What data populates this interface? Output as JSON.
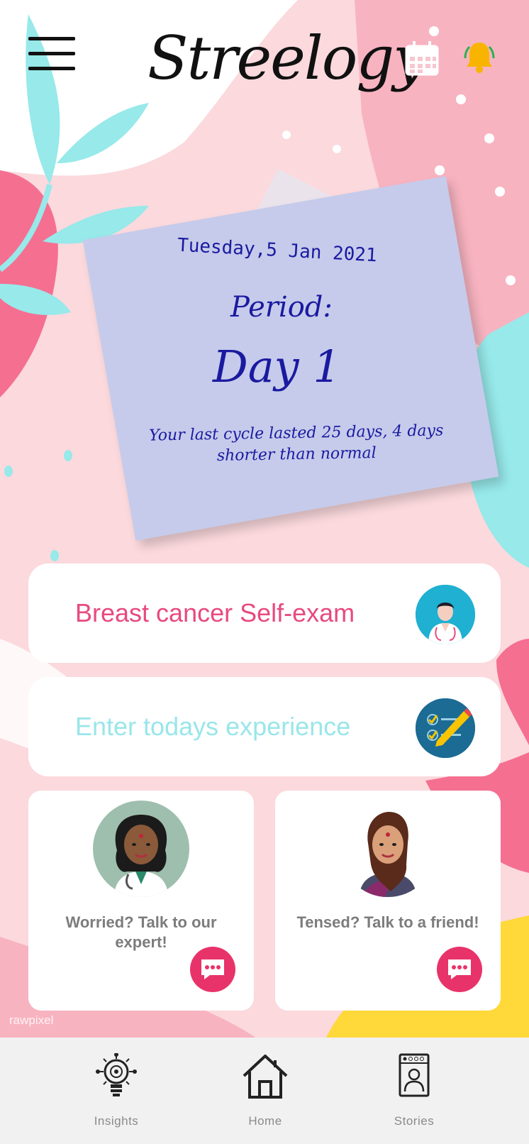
{
  "app": {
    "logo_text": "Streelogy"
  },
  "header": {
    "menu_icon": "hamburger-menu-icon",
    "calendar_icon": "calendar-icon",
    "bell_icon": "bell-icon",
    "bell_color": "#f8b400"
  },
  "note": {
    "date": "Tuesday,5 Jan 2021",
    "period_label": "Period:",
    "day": "Day 1",
    "message": "Your last  cycle lasted 25 days, 4 days shorter than normal"
  },
  "cards": [
    {
      "label": "Breast cancer Self-exam",
      "icon": "doctor-avatar-icon",
      "color": "#e84a7e"
    },
    {
      "label": "Enter todays experience",
      "icon": "checklist-pencil-icon",
      "color": "#99e6ea"
    }
  ],
  "talk": [
    {
      "text": "Worried? Talk to our expert!",
      "icon": "doctor-woman-avatar-icon"
    },
    {
      "text": "Tensed? Talk to a friend!",
      "icon": "woman-friend-avatar-icon"
    }
  ],
  "watermark": "rawpixel",
  "nav": [
    {
      "label": "Insights",
      "icon": "lightbulb-brain-icon"
    },
    {
      "label": "Home",
      "icon": "home-icon"
    },
    {
      "label": "Stories",
      "icon": "stories-person-icon"
    }
  ],
  "colors": {
    "accent_pink": "#e84a7e",
    "accent_teal": "#99e6ea",
    "note": "#c6cbeb",
    "chat_button": "#e8336a"
  }
}
